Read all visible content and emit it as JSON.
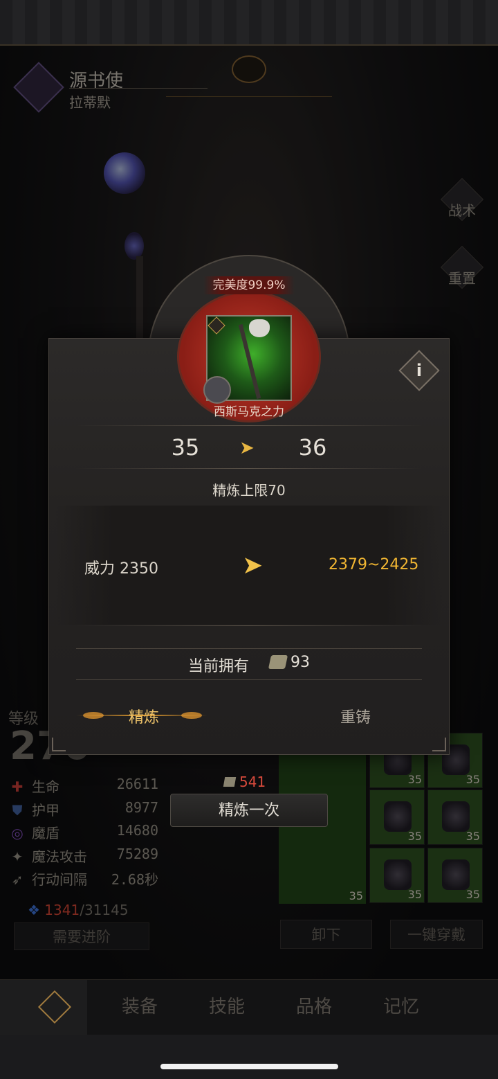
{
  "character": {
    "class_name": "源书使",
    "name": "拉蒂默"
  },
  "side_menu": {
    "tactics": "战术",
    "reset": "重置"
  },
  "refine_dialog": {
    "perfection": "完美度99.9%",
    "item_name": "西斯马克之力",
    "level_from": "35",
    "level_to": "36",
    "refine_limit": "精炼上限70",
    "power_label": "威力 2350",
    "power_new": "2379~2425",
    "owned_label": "当前拥有",
    "owned_count": "93",
    "tabs": {
      "refine": "精炼",
      "reforge": "重铸"
    }
  },
  "stats": {
    "level_label": "等级",
    "level_value": "270",
    "rows": [
      {
        "icon": "heart-cross-icon",
        "label": "生命",
        "value": "26611",
        "color": "#b83a33"
      },
      {
        "icon": "shield-icon",
        "label": "护甲",
        "value": "8977",
        "color": "#3d5a92"
      },
      {
        "icon": "magic-shield-icon",
        "label": "魔盾",
        "value": "14680",
        "color": "#7a4ab0"
      },
      {
        "icon": "magic-attack-icon",
        "label": "魔法攻击",
        "value": "75289",
        "color": "#8d877d"
      },
      {
        "icon": "action-interval-icon",
        "label": "行动间隔",
        "value": "2.68秒",
        "color": "#8d877d"
      }
    ],
    "exp_current": "1341",
    "exp_total": "/31145",
    "advance_button": "需要进阶"
  },
  "refine_cost": "541",
  "refine_once_button": "精炼一次",
  "equipment": {
    "slot_level": "35",
    "unequip_button": "卸下",
    "equip_all_button": "一键穿戴"
  },
  "bottom_nav": {
    "equipment": "装备",
    "skills": "技能",
    "personality": "品格",
    "memory": "记忆"
  },
  "colors": {
    "accent_gold": "#f1b632",
    "cost_red": "#d84a3c",
    "exp_red": "#c04030"
  }
}
